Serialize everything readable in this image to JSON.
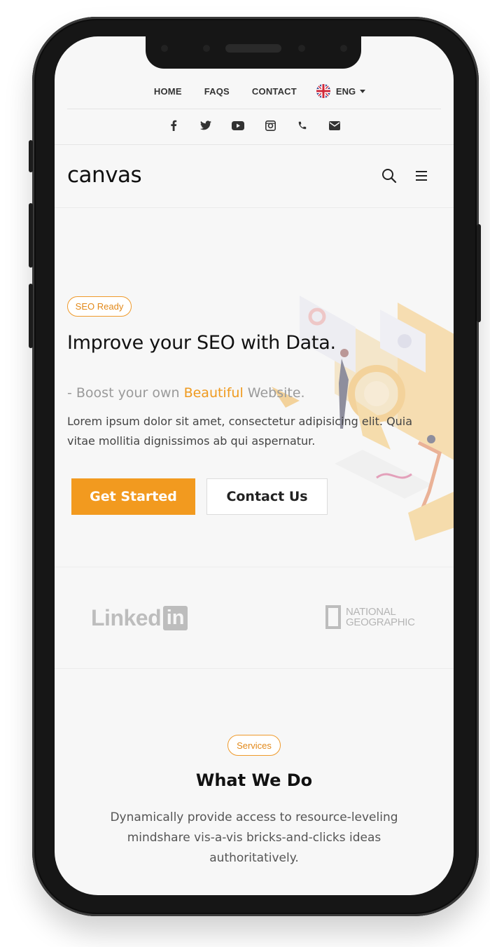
{
  "topnav": {
    "items": [
      "HOME",
      "FAQS",
      "CONTACT"
    ],
    "language": "ENG"
  },
  "social": [
    "facebook-icon",
    "twitter-icon",
    "youtube-icon",
    "instagram-icon",
    "phone-icon",
    "email-icon"
  ],
  "header": {
    "logo": "canvas"
  },
  "hero": {
    "badge": "SEO Ready",
    "title": "Improve your SEO with Data.",
    "subtitle_prefix": "- Boost your own ",
    "subtitle_highlight": "Beautiful",
    "subtitle_suffix": " Website.",
    "description": "Lorem ipsum dolor sit amet, consectetur adipisicing elit. Quia vitae mollitia dignissimos ab qui aspernatur.",
    "primary_button": "Get Started",
    "secondary_button": "Contact Us"
  },
  "logos": {
    "linkedin_word": "Linked",
    "linkedin_box": "in",
    "natgeo_line1": "NATIONAL",
    "natgeo_line2": "GEOGRAPHIC"
  },
  "services": {
    "badge": "Services",
    "title": "What We Do",
    "description": "Dynamically provide access to resource-leveling mindshare vis-a-vis bricks-and-clicks ideas authoritatively."
  },
  "colors": {
    "accent": "#f29a1f",
    "text": "#111111"
  }
}
